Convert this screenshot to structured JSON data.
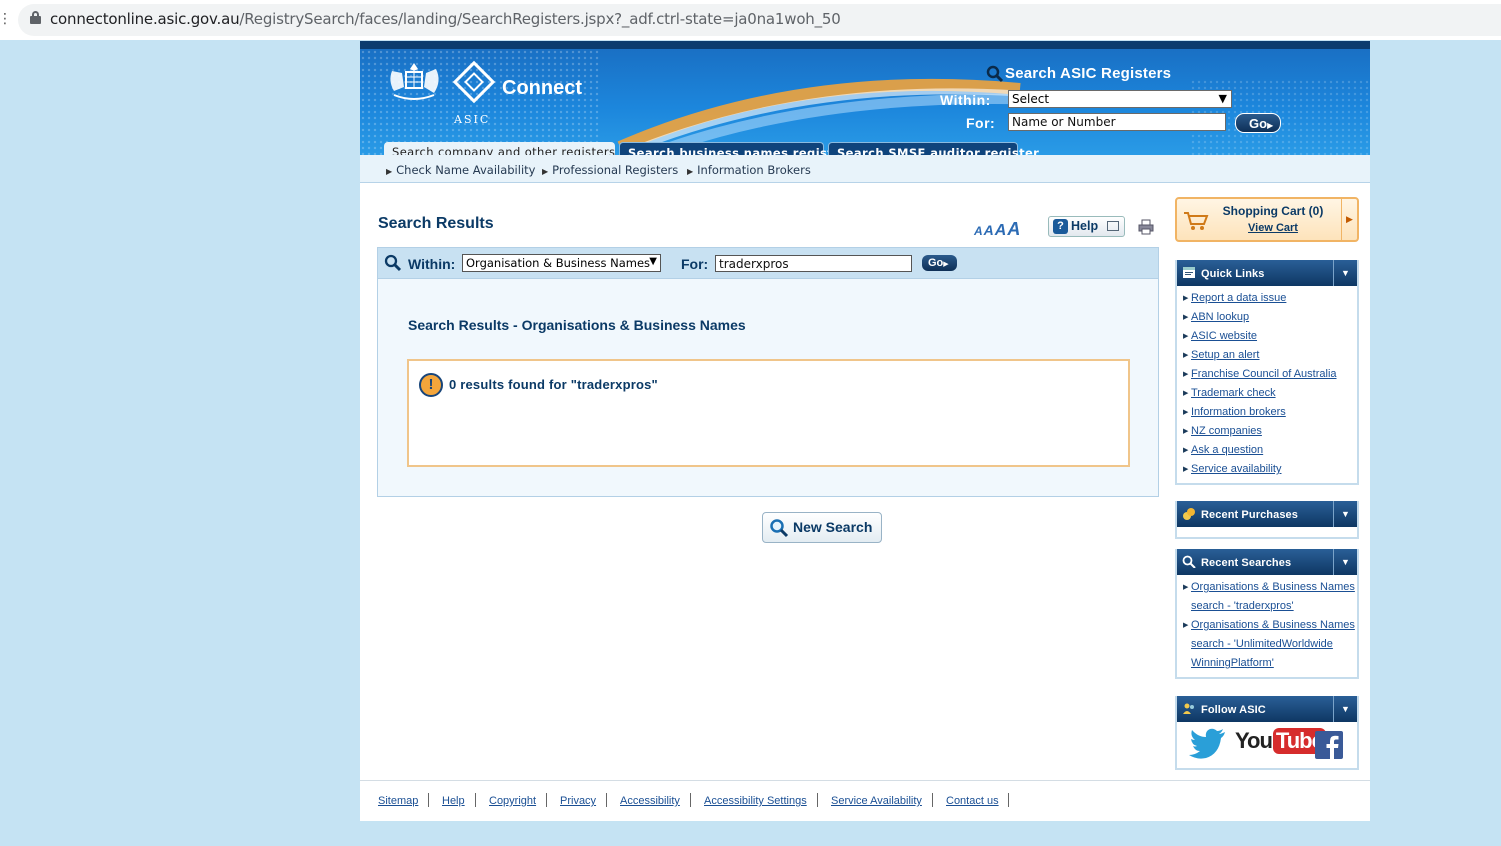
{
  "browser": {
    "url_domain": "connectonline.asic.gov.au",
    "url_path": "/RegistrySearch/faces/landing/SearchRegisters.jspx?_adf.ctrl-state=ja0na1woh_50"
  },
  "header": {
    "logo_text": "ASIC",
    "app_name": "Connect",
    "search_title": "Search ASIC Registers",
    "within_label": "Within:",
    "within_value": "Select",
    "for_label": "For:",
    "for_placeholder": "Name or Number",
    "go_label": "Go",
    "tabs": [
      {
        "label": "Search company and other registers",
        "active": true
      },
      {
        "label": "Search business names register",
        "active": false
      },
      {
        "label": "Search SMSF auditor register",
        "active": false
      }
    ],
    "subnav": [
      {
        "label": "Check Name Availability"
      },
      {
        "label": "Professional Registers"
      },
      {
        "label": "Information Brokers"
      }
    ]
  },
  "main": {
    "title": "Search Results",
    "help_label": "Help",
    "font_sizes": [
      "A",
      "A",
      "A",
      "A"
    ],
    "searchbar": {
      "within_label": "Within:",
      "within_value": "Organisation & Business Names",
      "for_label": "For:",
      "for_value": "traderxpros",
      "go_label": "Go"
    },
    "results_heading": "Search Results - Organisations & Business Names",
    "results_message": "0 results found for \"traderxpros\"",
    "new_search_label": "New Search"
  },
  "sidebar": {
    "cart": {
      "title": "Shopping Cart (0)",
      "view_label": "View Cart"
    },
    "quick_links": {
      "title": "Quick Links",
      "items": [
        "Report a data issue",
        "ABN lookup",
        "ASIC website",
        "Setup an alert",
        "Franchise Council of Australia",
        "Trademark check",
        "Information brokers",
        "NZ companies",
        "Ask a question",
        "Service availability"
      ]
    },
    "recent_purchases": {
      "title": "Recent Purchases"
    },
    "recent_searches": {
      "title": "Recent Searches",
      "items": [
        {
          "line1": "Organisations & Business Names",
          "line2": "search - 'traderxpros'"
        },
        {
          "line1": "Organisations & Business Names",
          "line2": "search - 'UnlimitedWorldwide",
          "line3": "WinningPlatform'"
        }
      ]
    },
    "follow": {
      "title": "Follow ASIC",
      "youtube_you": "You",
      "youtube_tube": "Tube"
    }
  },
  "footer": {
    "links": [
      "Sitemap",
      "Help",
      "Copyright",
      "Privacy",
      "Accessibility",
      "Accessibility Settings",
      "Service Availability",
      "Contact us"
    ]
  },
  "colors": {
    "banner_blue": "#1c86dc",
    "navy": "#0b3a66",
    "link_blue": "#1a4f94",
    "result_border": "#f0c58a",
    "page_bg": "#c5e3f3"
  }
}
